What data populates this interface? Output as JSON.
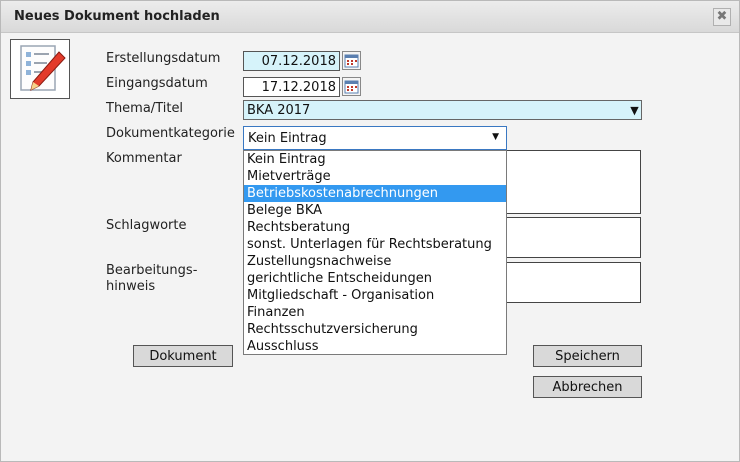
{
  "dialog": {
    "title": "Neues Dokument hochladen",
    "close_icon": "close-icon"
  },
  "form": {
    "created_date_label": "Erstellungsdatum",
    "created_date_value": "07.12.2018",
    "received_date_label": "Eingangsdatum",
    "received_date_value": "17.12.2018",
    "topic_label": "Thema/Titel",
    "topic_value": "BKA 2017",
    "category_label": "Dokumentkategorie",
    "category_value": "Kein Eintrag",
    "comment_label": "Kommentar",
    "keywords_label": "Schlagworte",
    "note_label_line1": "Bearbeitungs-",
    "note_label_line2": "hinweis"
  },
  "category_options": [
    "Kein Eintrag",
    "Mietverträge",
    "Betriebskostenabrechnungen",
    "Belege BKA",
    "Rechtsberatung",
    "sonst. Unterlagen für Rechtsberatung",
    "Zustellungsnachweise",
    "gerichtliche Entscheidungen",
    "Mitgliedschaft - Organisation",
    "Finanzen",
    "Rechtsschutzversicherung",
    "Ausschluss"
  ],
  "highlighted_option": "Betriebskostenabrechnungen",
  "buttons": {
    "document": "Dokument",
    "save": "Speichern",
    "cancel": "Abbrechen"
  },
  "colors": {
    "field_bg": "#d6f3fa",
    "highlight": "#3399f0",
    "focus_border": "#3a78c2"
  }
}
